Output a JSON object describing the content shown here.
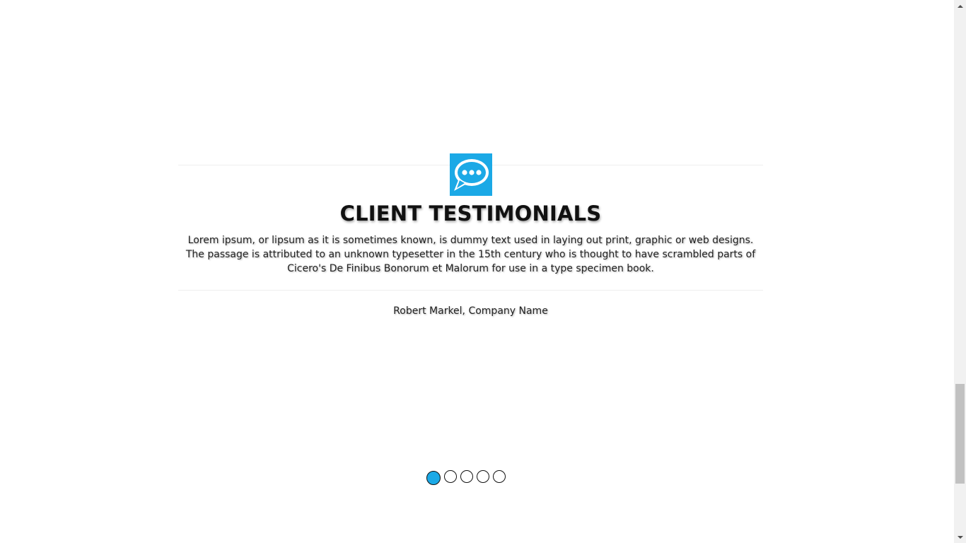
{
  "testimonial": {
    "icon": "chat-bubble-icon",
    "title": "CLIENT TESTIMONIALS",
    "quote": "Lorem ipsum, or lipsum as it is sometimes known, is dummy text used in laying out print, graphic or web designs. The passage is attributed to an unknown typesetter in the 15th century who is thought to have scrambled parts of Cicero's De Finibus Bonorum et Malorum for use in a type specimen book.",
    "author": "Robert Markel, Company Name"
  },
  "carousel": {
    "slide_count": 5,
    "active_index": 0
  },
  "colors": {
    "accent": "#1ba9e6",
    "text": "#111111",
    "rule": "#eeeeee"
  },
  "scrollbar": {
    "up_icon": "arrow-up-icon",
    "down_icon": "arrow-down-icon"
  }
}
